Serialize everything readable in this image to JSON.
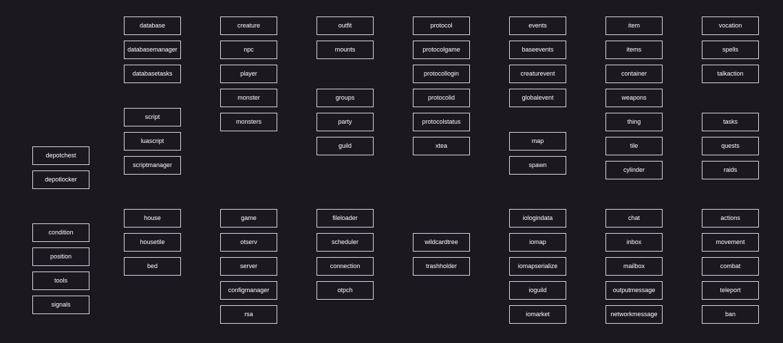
{
  "colors": {
    "background": "#1c1820",
    "box_border": "#d8d8d8",
    "text": "#ffffff"
  },
  "nodes": [
    "depotchest",
    "depotlocker",
    "condition",
    "position",
    "tools",
    "signals",
    "database",
    "databasemanager",
    "databasetasks",
    "script",
    "luascript",
    "scriptmanager",
    "house",
    "housetile",
    "bed",
    "creature",
    "npc",
    "player",
    "monster",
    "monsters",
    "game",
    "otserv",
    "server",
    "configmanager",
    "rsa",
    "outfit",
    "mounts",
    "groups",
    "party",
    "guild",
    "fileloader",
    "scheduler",
    "connection",
    "otpch",
    "protocol",
    "protocolgame",
    "protocollogin",
    "protocolid",
    "protocolstatus",
    "xtea",
    "wildcardtree",
    "trashholder",
    "events",
    "baseevents",
    "creaturevent",
    "globalevent",
    "map",
    "spawn",
    "iologindata",
    "iomap",
    "iomapserialize",
    "ioguild",
    "iomarket",
    "item",
    "items",
    "container",
    "weapons",
    "thing",
    "tile",
    "cylinder",
    "chat",
    "inbox",
    "mailbox",
    "outputmessage",
    "networkmessage",
    "vocation",
    "spells",
    "talkaction",
    "tasks",
    "quests",
    "raids",
    "actions",
    "movement",
    "combat",
    "teleport",
    "ban"
  ]
}
